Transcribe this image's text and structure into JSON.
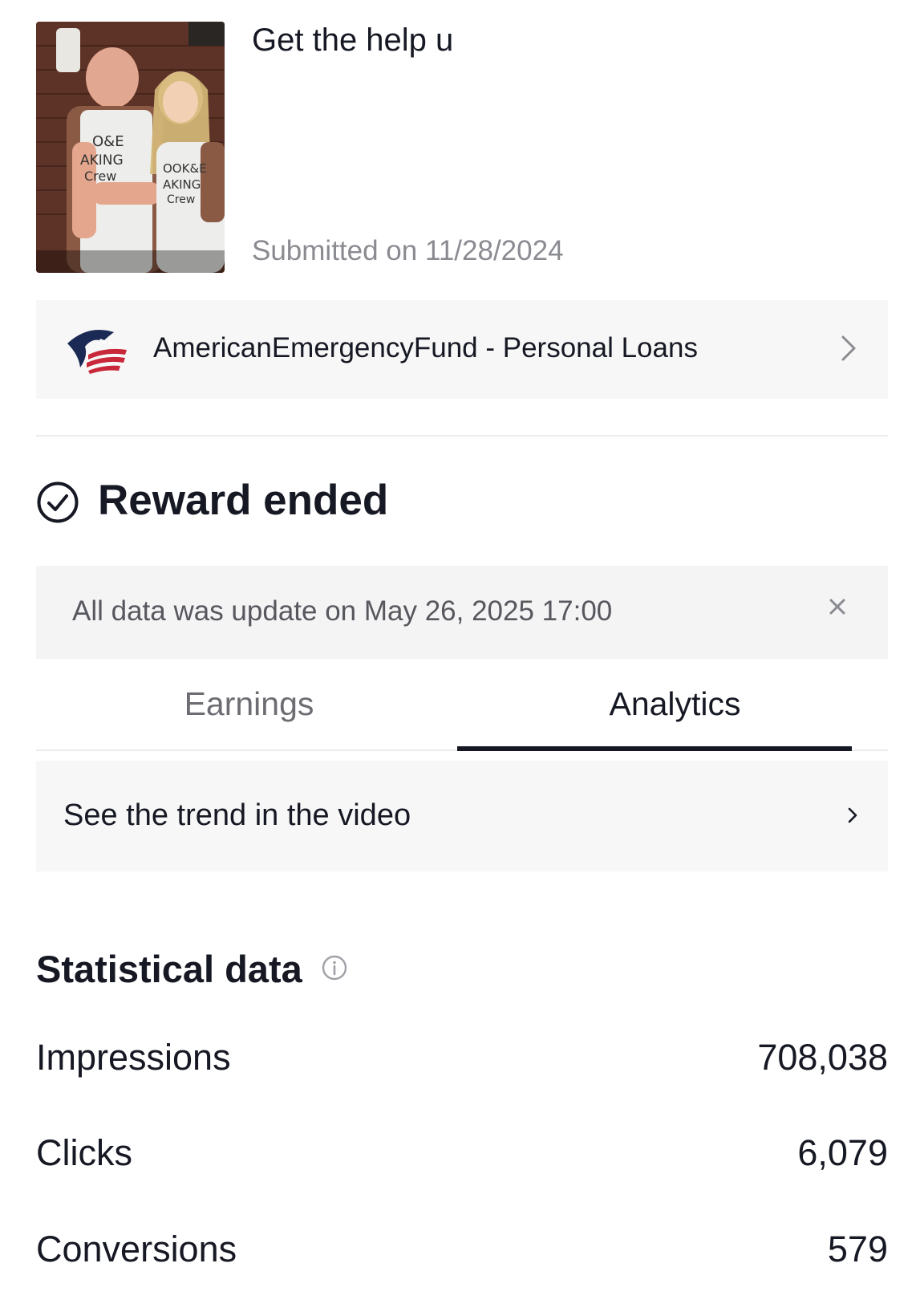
{
  "video": {
    "title": "Get the help u",
    "submitted": "Submitted on 11/28/2024"
  },
  "advertiser": {
    "name": "AmericanEmergencyFund - Personal Loans",
    "logo_icon": "eagle-flag-logo-icon",
    "chevron_icon": "chevron-right-icon"
  },
  "reward": {
    "status": "Reward ended",
    "icon": "check-circle-icon"
  },
  "notice": {
    "text": "All data was update on May 26, 2025 17:00",
    "close_icon": "close-icon"
  },
  "tabs": [
    {
      "label": "Earnings",
      "active": false
    },
    {
      "label": "Analytics",
      "active": true
    }
  ],
  "trend": {
    "label": "See the trend in the video",
    "chevron_icon": "chevron-right-icon"
  },
  "stats": {
    "title": "Statistical data",
    "info_icon": "info-icon",
    "rows": [
      {
        "label": "Impressions",
        "value": "708,038"
      },
      {
        "label": "Clicks",
        "value": "6,079"
      },
      {
        "label": "Conversions",
        "value": "579"
      }
    ]
  },
  "colors": {
    "text_primary": "#161823",
    "text_secondary": "#8a8b91",
    "card_bg": "#f7f7f7",
    "notice_bg": "#f4f4f5",
    "logo_navy": "#1b2a55",
    "logo_red": "#c8283a"
  }
}
